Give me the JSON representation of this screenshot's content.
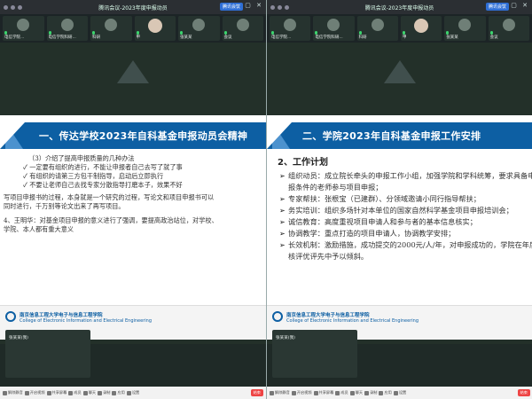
{
  "left": {
    "window_title": "腾讯会议-2023年度申报动员",
    "rec_label": "腾讯会议",
    "participants": [
      {
        "name": "电信学院...",
        "cam": false
      },
      {
        "name": "电信学院科研...",
        "cam": false
      },
      {
        "name": "科研",
        "cam": false
      },
      {
        "name": "甲",
        "cam": true
      },
      {
        "name": "张某某",
        "cam": false
      },
      {
        "name": "会议",
        "cam": false
      }
    ],
    "slide": {
      "banner": "一、传达学校2023年自科基金申报动员会精神",
      "lines": [
        "（3）介绍了提高申报质量的几种办法",
        "✓ 一定要有组织的进行，不能让申报者自己去写了就了事",
        "✓ 有组织的请第三方包干制指导，启动后立即执行",
        "✓ 不要让老师自己去找专家分散指导打磨本子，效果不好",
        "写项目申报书的过程，本身就是一个研究的过程，写论文和项目申报书可以",
        "同时进行，千万别等论文出来了再写项目。",
        "",
        "4、王明华：对基金项目申报的意义进行了强调，要提高政治站位，对学校、",
        "学院、本人都有重大意义"
      ],
      "footer_cn": "南京信息工程大学电子与信息工程学院",
      "footer_en": "College of Electronic Information and Electrical Engineering"
    },
    "self_name": "张某某(我)",
    "toolbar": [
      "解除静音",
      "开启视频",
      "共享屏幕",
      "成员",
      "聊天",
      "录制",
      "应用",
      "设置",
      "结束"
    ]
  },
  "right": {
    "window_title": "腾讯会议-2023年度申报动员",
    "rec_label": "腾讯会议",
    "participants": [
      {
        "name": "电信学院...",
        "cam": false
      },
      {
        "name": "电信学院科研...",
        "cam": false
      },
      {
        "name": "科研",
        "cam": false
      },
      {
        "name": "甲",
        "cam": true
      },
      {
        "name": "张某某",
        "cam": false
      },
      {
        "name": "会议",
        "cam": false
      }
    ],
    "slide": {
      "banner": "二、学院2023年自科基金申报工作安排",
      "heading": "2、工作计划",
      "items": [
        {
          "text": "组织动员：成立院长牵头的申报工作小组，加强学院和学科统筹，要求具备申",
          "cont": "报条件的老师参与项目申报；"
        },
        {
          "text": "专家帮扶：张根宝（已建群）、分领域邀请小同行指导帮扶；",
          "cont": ""
        },
        {
          "text": "务实培训：组织多场针对本单位的国家自然科学基金项目申报培训会；",
          "cont": ""
        },
        {
          "text": "诚信教育：高度重视项目申请人和参与者的基本信息核实；",
          "cont": ""
        },
        {
          "text": "协调教学：重点打造的项目申请人，协调教学安排；",
          "cont": ""
        },
        {
          "text": "长效机制：激励措施，成功提交的2000元/人/年，对申报成功的，学院在年度考",
          "cont": "核评优评先中予以倾斜。"
        }
      ],
      "footer_cn": "南京信息工程大学电子与信息工程学院",
      "footer_en": "College of Electronic Information and Electrical Engineering"
    },
    "self_name": "张某某(我)",
    "toolbar": [
      "解除静音",
      "开启视频",
      "共享屏幕",
      "成员",
      "聊天",
      "录制",
      "应用",
      "设置",
      "结束"
    ]
  }
}
